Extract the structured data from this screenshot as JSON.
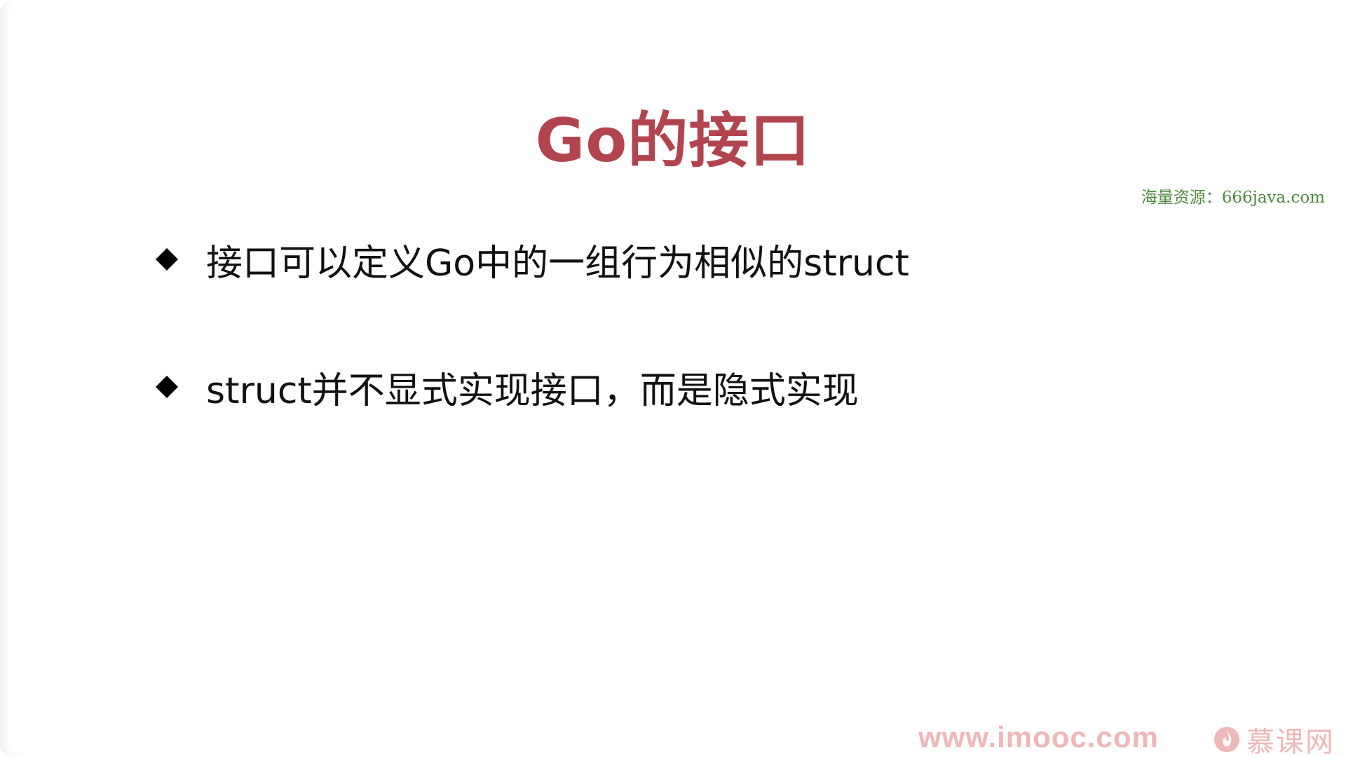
{
  "slide": {
    "title": "Go的接口",
    "watermark": "海量资源：666java.com",
    "bullets": [
      {
        "text": "接口可以定义Go中的一组行为相似的struct",
        "icon": "diamond-bullet-icon"
      },
      {
        "text": "struct并不显式实现接口，而是隐式实现",
        "icon": "diamond-bullet-icon"
      }
    ]
  },
  "footer": {
    "site": "www.imooc.com",
    "brand": "慕课网",
    "brand_icon": "flame-logo-icon"
  },
  "colors": {
    "title": "#b2444e",
    "watermark": "#4d8a3c",
    "text": "#111111",
    "footer": "#efb7b7"
  }
}
